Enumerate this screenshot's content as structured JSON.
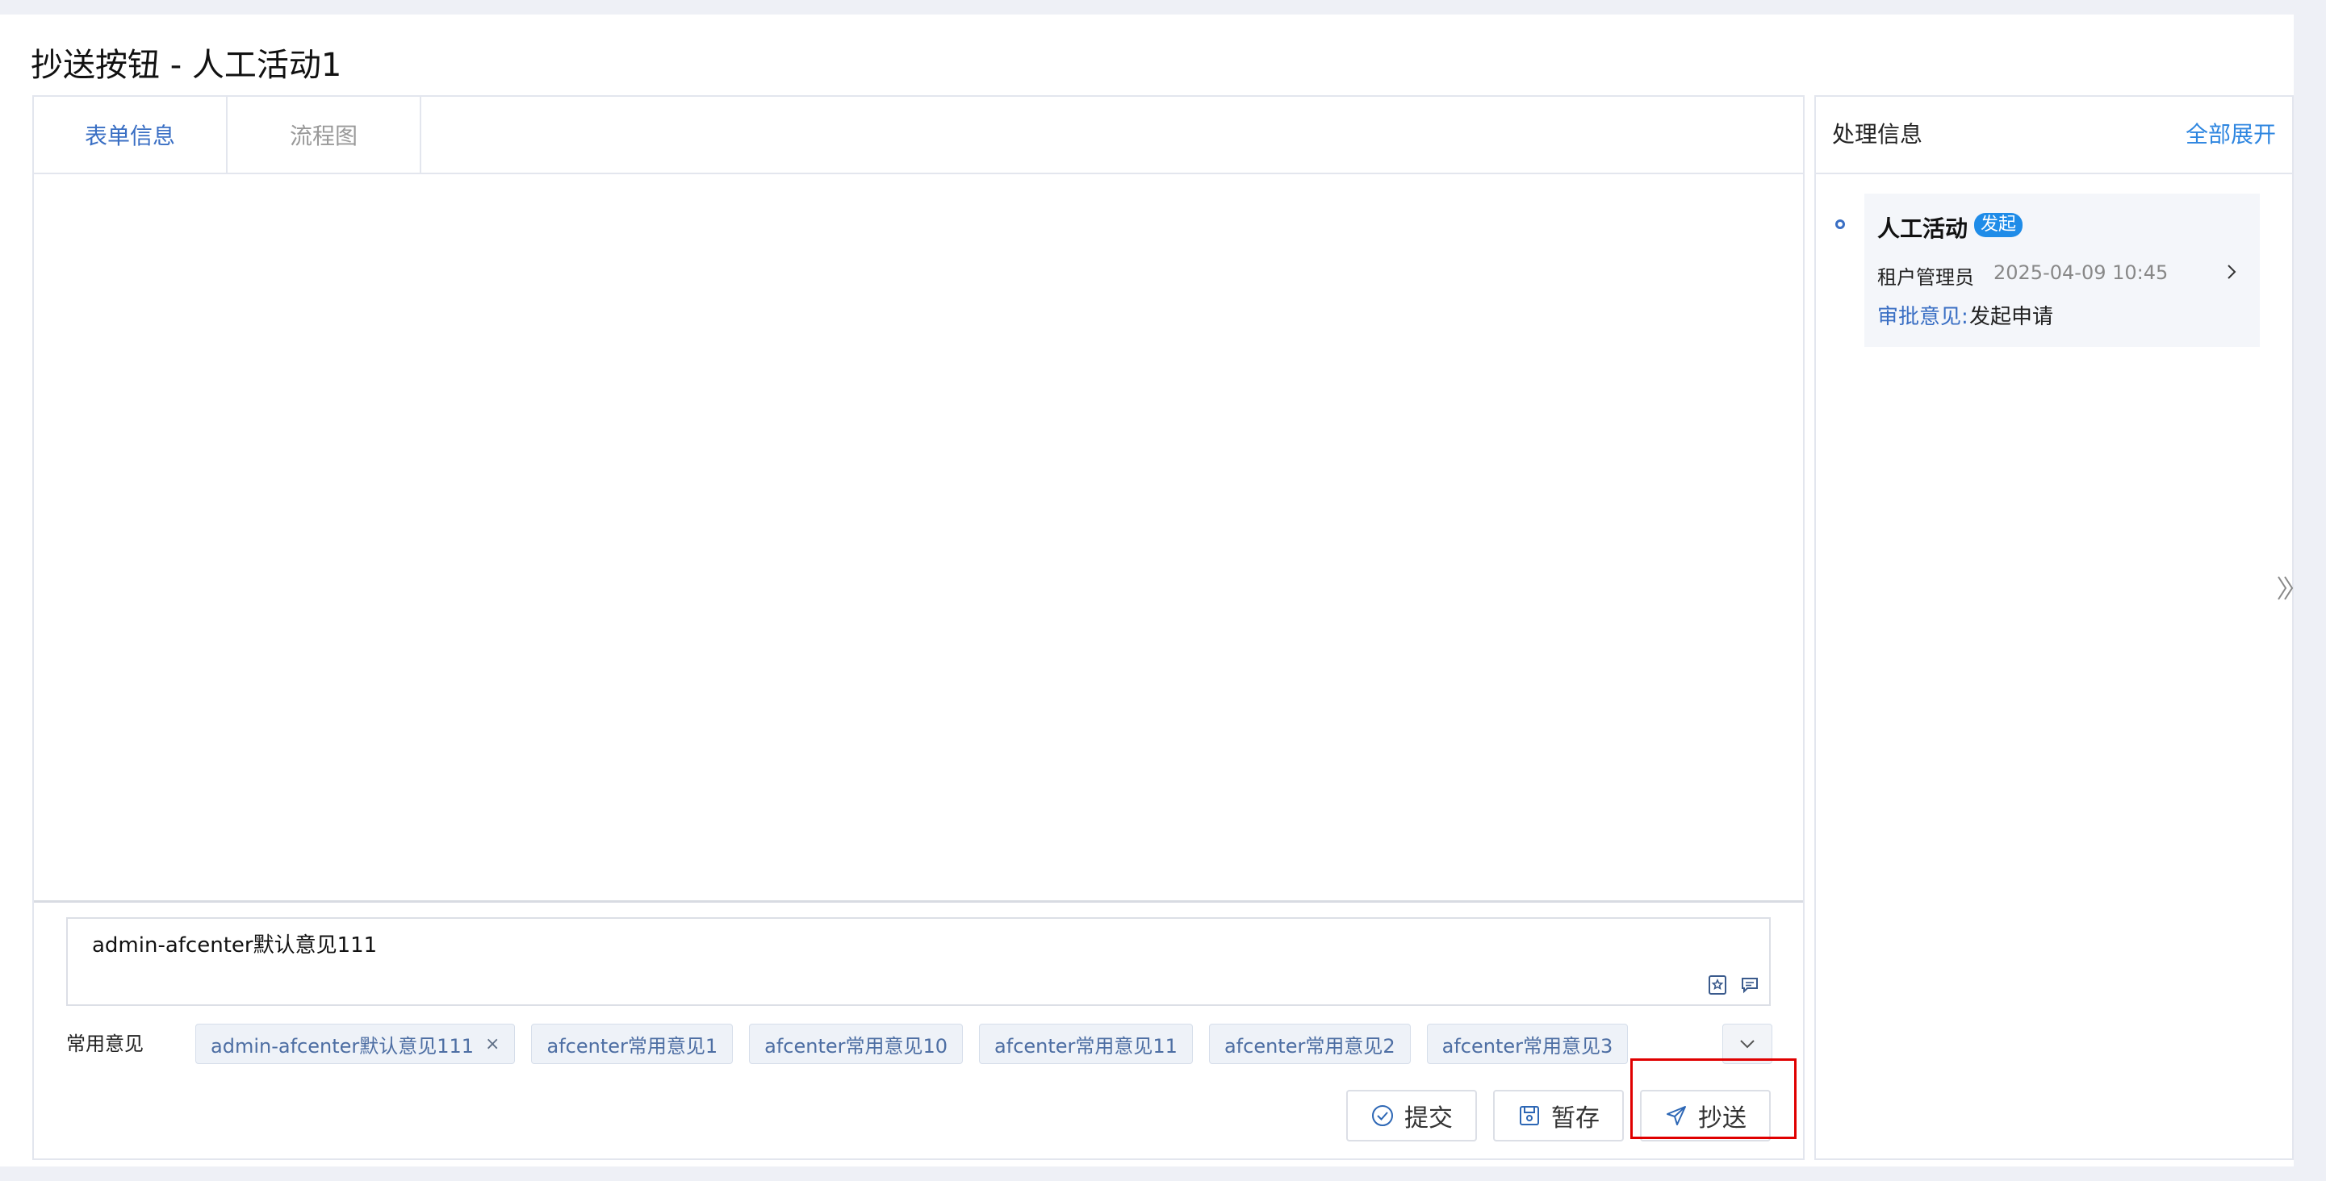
{
  "page": {
    "title": "抄送按钮 - 人工活动1"
  },
  "tabs": [
    {
      "label": "表单信息",
      "active": true
    },
    {
      "label": "流程图",
      "active": false
    }
  ],
  "opinion": {
    "text": "admin-afcenter默认意见111",
    "icons": [
      "favorite-opinion-icon",
      "comment-icon"
    ]
  },
  "common": {
    "label": "常用意见",
    "tags": [
      "admin-afcenter默认意见111",
      "afcenter常用意见1",
      "afcenter常用意见10",
      "afcenter常用意见11",
      "afcenter常用意见2",
      "afcenter常用意见3"
    ]
  },
  "actions": {
    "submit": "提交",
    "save": "暂存",
    "cc": "抄送"
  },
  "side": {
    "title": "处理信息",
    "expand_all": "全部展开",
    "activity": {
      "title": "人工活动",
      "badge": "发起",
      "user": "租户管理员",
      "time": "2025-04-09 10:45",
      "approval_label": "审批意见:",
      "approval_value": "发起申请"
    }
  },
  "colors": {
    "accent": "#3a6fc4",
    "link": "#2e86e0",
    "badge": "#1f8ce8",
    "highlight": "#e00000"
  }
}
